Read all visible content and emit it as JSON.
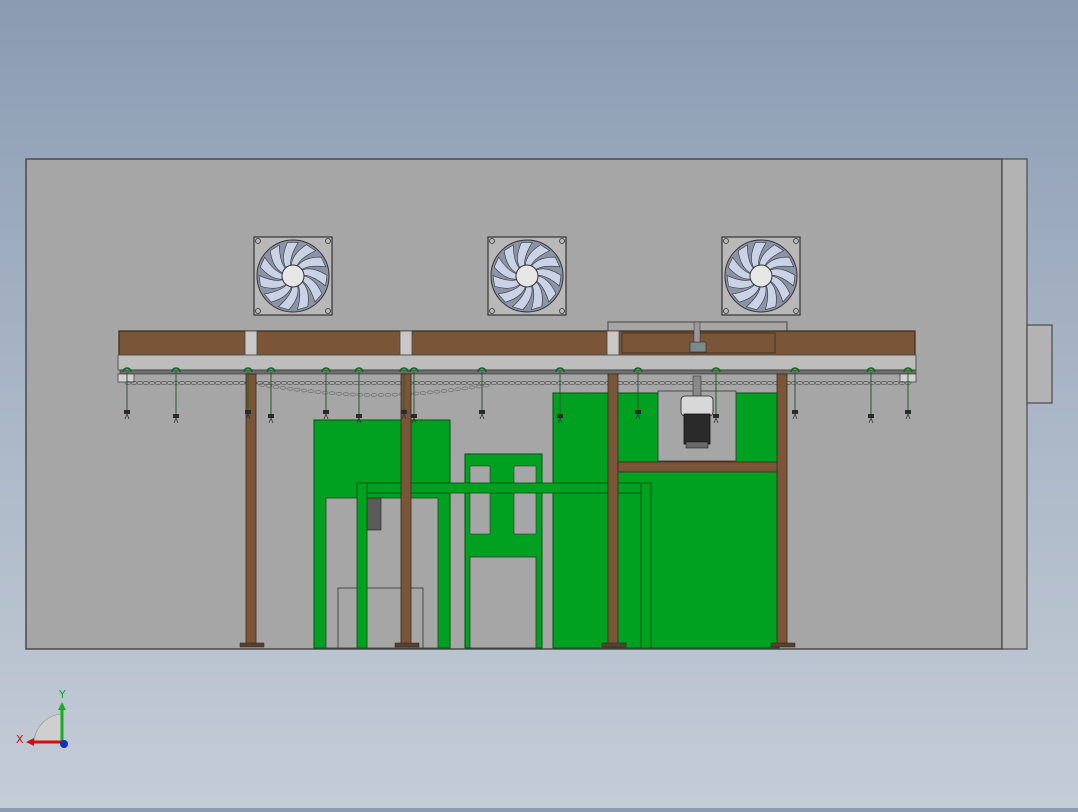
{
  "viewport": {
    "background_top": "#8a9bb2",
    "background_bottom": "#c4ccd6"
  },
  "model": {
    "wall_color": "#a6a6a6",
    "frame_color": "#7a5538",
    "frame_dark": "#4a3322",
    "machine_green": "#00a020",
    "machine_green_dark": "#007014",
    "fan_blade_color": "#c9d2e6",
    "fan_count": 3,
    "hanger_count": 14
  },
  "triad": {
    "x_label": "X",
    "y_label": "Y",
    "x_color": "#d01010",
    "y_color": "#10b020",
    "z_color": "#1030c0"
  }
}
